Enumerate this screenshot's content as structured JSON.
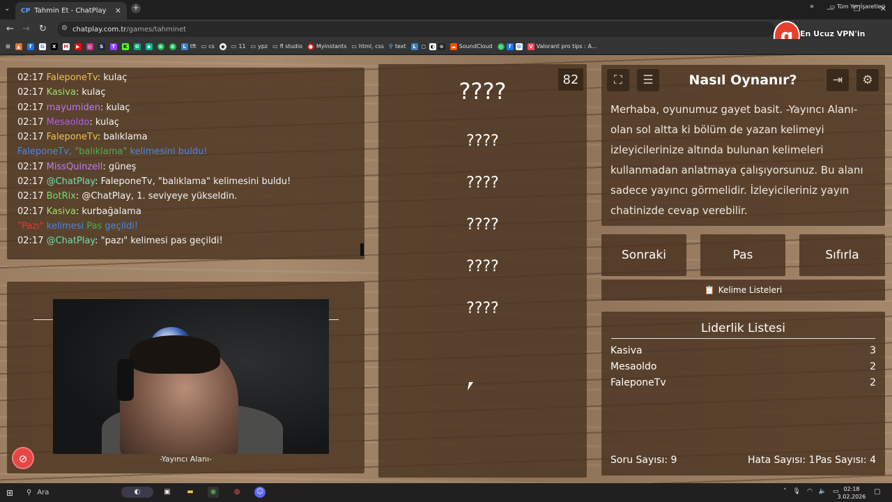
{
  "browser": {
    "tab_title": "Tahmin Et - ChatPlay",
    "tab_favicon": "CP",
    "url_host": "chatplay.com.tr",
    "url_path": "/games/tahminet",
    "ext_text": "En Ucuz VPN'in Adresi!",
    "bookmarks": [
      "tft",
      "cs",
      "11",
      "ypz",
      "fl studio",
      "Myinstants",
      "html, css",
      "text",
      "SoundCloud",
      "Valorant pro tips : A..."
    ],
    "all_bookmarks": "Tüm Yer İşaretleri"
  },
  "chat": {
    "lines": [
      {
        "time": "02:17",
        "user": "FaleponeTv",
        "color": "#f0c050",
        "msg": ": kulaç"
      },
      {
        "time": "02:17",
        "user": "Kasiva",
        "color": "#9be36b",
        "msg": ": kulaç"
      },
      {
        "time": "02:17",
        "user": "mayumiden",
        "color": "#c07cf0",
        "msg": ": kulaç"
      },
      {
        "time": "02:17",
        "user": "Mesaoldo",
        "color": "#b05cf0",
        "msg": ": kulaç"
      },
      {
        "time": "02:17",
        "user": "FaleponeTv",
        "color": "#f0c050",
        "msg": ": balıklama"
      },
      {
        "time": "02:17",
        "user": "MissQuinzell",
        "color": "#c07cf0",
        "msg": ": güneş"
      },
      {
        "time": "02:17",
        "user": "@ChatPlay",
        "color": "#6ee0b0",
        "msg": ": FaleponeTv, \"balıklama\" kelimesini buldu!"
      },
      {
        "time": "02:17",
        "user": "BotRix",
        "color": "#6ee06e",
        "msg": ": @ChatPlay, 1. seviyeye yükseldin."
      },
      {
        "time": "02:17",
        "user": "Kasiva",
        "color": "#9be36b",
        "msg": ": kurbağalama"
      },
      {
        "time": "02:17",
        "user": "@ChatPlay",
        "color": "#6ee0b0",
        "msg": ": \"pazı\" kelimesi pas geçildi!"
      }
    ],
    "found_notice": {
      "user": "FaleponeTv, ",
      "word": "\"balıklama\"",
      "rest": " kelimesini buldu!"
    },
    "pass_notice": {
      "word": "\"Pazı\"",
      "mid": " kelimesi ",
      "pas": "Pas",
      "rest": " geçildi!"
    }
  },
  "camera": {
    "caption": "-Yayıncı Alanı-"
  },
  "game": {
    "counter": "82",
    "main_word": "????",
    "words": [
      "????",
      "????",
      "????",
      "????",
      "????"
    ]
  },
  "info": {
    "title": "Nasıl Oynanır?",
    "text": "Merhaba, oyunumuz gayet basit. -Yayıncı Alanı- olan sol altta ki bölüm de yazan kelimeyi izleyicilerinize altında bulunan kelimeleri kullanmadan anlatmaya çalışıyorsunuz. Bu alanı sadece yayıncı görmelidir. İzleyicileriniz yayın chatinizde cevap verebilir."
  },
  "controls": {
    "next": "Sonraki",
    "pass": "Pas",
    "reset": "Sıfırla",
    "word_lists": "Kelime Listeleri"
  },
  "leaderboard": {
    "title": "Liderlik Listesi",
    "rows": [
      {
        "name": "Kasiva",
        "score": "3"
      },
      {
        "name": "Mesaoldo",
        "score": "2"
      },
      {
        "name": "FaleponeTv",
        "score": "2"
      }
    ],
    "questions": "Soru Sayısı: 9",
    "mistakes": "Hata Sayısı: 1",
    "passes": "Pas Sayısı: 4"
  },
  "taskbar": {
    "search": "Ara",
    "time": "02:18",
    "date": "3.02.2026"
  }
}
